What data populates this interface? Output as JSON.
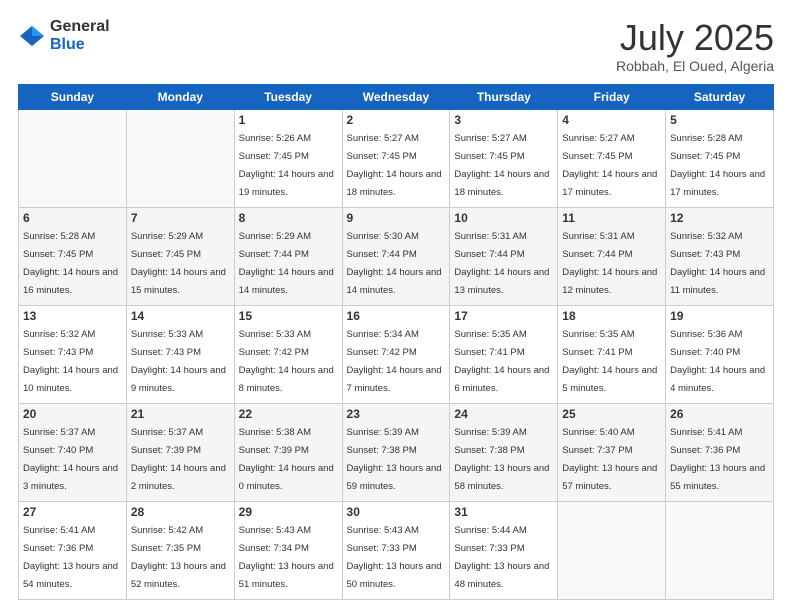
{
  "logo": {
    "general": "General",
    "blue": "Blue"
  },
  "header": {
    "month": "July 2025",
    "location": "Robbah, El Oued, Algeria"
  },
  "weekdays": [
    "Sunday",
    "Monday",
    "Tuesday",
    "Wednesday",
    "Thursday",
    "Friday",
    "Saturday"
  ],
  "weeks": [
    [
      {
        "day": "",
        "sunrise": "",
        "sunset": "",
        "daylight": ""
      },
      {
        "day": "",
        "sunrise": "",
        "sunset": "",
        "daylight": ""
      },
      {
        "day": "1",
        "sunrise": "Sunrise: 5:26 AM",
        "sunset": "Sunset: 7:45 PM",
        "daylight": "Daylight: 14 hours and 19 minutes."
      },
      {
        "day": "2",
        "sunrise": "Sunrise: 5:27 AM",
        "sunset": "Sunset: 7:45 PM",
        "daylight": "Daylight: 14 hours and 18 minutes."
      },
      {
        "day": "3",
        "sunrise": "Sunrise: 5:27 AM",
        "sunset": "Sunset: 7:45 PM",
        "daylight": "Daylight: 14 hours and 18 minutes."
      },
      {
        "day": "4",
        "sunrise": "Sunrise: 5:27 AM",
        "sunset": "Sunset: 7:45 PM",
        "daylight": "Daylight: 14 hours and 17 minutes."
      },
      {
        "day": "5",
        "sunrise": "Sunrise: 5:28 AM",
        "sunset": "Sunset: 7:45 PM",
        "daylight": "Daylight: 14 hours and 17 minutes."
      }
    ],
    [
      {
        "day": "6",
        "sunrise": "Sunrise: 5:28 AM",
        "sunset": "Sunset: 7:45 PM",
        "daylight": "Daylight: 14 hours and 16 minutes."
      },
      {
        "day": "7",
        "sunrise": "Sunrise: 5:29 AM",
        "sunset": "Sunset: 7:45 PM",
        "daylight": "Daylight: 14 hours and 15 minutes."
      },
      {
        "day": "8",
        "sunrise": "Sunrise: 5:29 AM",
        "sunset": "Sunset: 7:44 PM",
        "daylight": "Daylight: 14 hours and 14 minutes."
      },
      {
        "day": "9",
        "sunrise": "Sunrise: 5:30 AM",
        "sunset": "Sunset: 7:44 PM",
        "daylight": "Daylight: 14 hours and 14 minutes."
      },
      {
        "day": "10",
        "sunrise": "Sunrise: 5:31 AM",
        "sunset": "Sunset: 7:44 PM",
        "daylight": "Daylight: 14 hours and 13 minutes."
      },
      {
        "day": "11",
        "sunrise": "Sunrise: 5:31 AM",
        "sunset": "Sunset: 7:44 PM",
        "daylight": "Daylight: 14 hours and 12 minutes."
      },
      {
        "day": "12",
        "sunrise": "Sunrise: 5:32 AM",
        "sunset": "Sunset: 7:43 PM",
        "daylight": "Daylight: 14 hours and 11 minutes."
      }
    ],
    [
      {
        "day": "13",
        "sunrise": "Sunrise: 5:32 AM",
        "sunset": "Sunset: 7:43 PM",
        "daylight": "Daylight: 14 hours and 10 minutes."
      },
      {
        "day": "14",
        "sunrise": "Sunrise: 5:33 AM",
        "sunset": "Sunset: 7:43 PM",
        "daylight": "Daylight: 14 hours and 9 minutes."
      },
      {
        "day": "15",
        "sunrise": "Sunrise: 5:33 AM",
        "sunset": "Sunset: 7:42 PM",
        "daylight": "Daylight: 14 hours and 8 minutes."
      },
      {
        "day": "16",
        "sunrise": "Sunrise: 5:34 AM",
        "sunset": "Sunset: 7:42 PM",
        "daylight": "Daylight: 14 hours and 7 minutes."
      },
      {
        "day": "17",
        "sunrise": "Sunrise: 5:35 AM",
        "sunset": "Sunset: 7:41 PM",
        "daylight": "Daylight: 14 hours and 6 minutes."
      },
      {
        "day": "18",
        "sunrise": "Sunrise: 5:35 AM",
        "sunset": "Sunset: 7:41 PM",
        "daylight": "Daylight: 14 hours and 5 minutes."
      },
      {
        "day": "19",
        "sunrise": "Sunrise: 5:36 AM",
        "sunset": "Sunset: 7:40 PM",
        "daylight": "Daylight: 14 hours and 4 minutes."
      }
    ],
    [
      {
        "day": "20",
        "sunrise": "Sunrise: 5:37 AM",
        "sunset": "Sunset: 7:40 PM",
        "daylight": "Daylight: 14 hours and 3 minutes."
      },
      {
        "day": "21",
        "sunrise": "Sunrise: 5:37 AM",
        "sunset": "Sunset: 7:39 PM",
        "daylight": "Daylight: 14 hours and 2 minutes."
      },
      {
        "day": "22",
        "sunrise": "Sunrise: 5:38 AM",
        "sunset": "Sunset: 7:39 PM",
        "daylight": "Daylight: 14 hours and 0 minutes."
      },
      {
        "day": "23",
        "sunrise": "Sunrise: 5:39 AM",
        "sunset": "Sunset: 7:38 PM",
        "daylight": "Daylight: 13 hours and 59 minutes."
      },
      {
        "day": "24",
        "sunrise": "Sunrise: 5:39 AM",
        "sunset": "Sunset: 7:38 PM",
        "daylight": "Daylight: 13 hours and 58 minutes."
      },
      {
        "day": "25",
        "sunrise": "Sunrise: 5:40 AM",
        "sunset": "Sunset: 7:37 PM",
        "daylight": "Daylight: 13 hours and 57 minutes."
      },
      {
        "day": "26",
        "sunrise": "Sunrise: 5:41 AM",
        "sunset": "Sunset: 7:36 PM",
        "daylight": "Daylight: 13 hours and 55 minutes."
      }
    ],
    [
      {
        "day": "27",
        "sunrise": "Sunrise: 5:41 AM",
        "sunset": "Sunset: 7:36 PM",
        "daylight": "Daylight: 13 hours and 54 minutes."
      },
      {
        "day": "28",
        "sunrise": "Sunrise: 5:42 AM",
        "sunset": "Sunset: 7:35 PM",
        "daylight": "Daylight: 13 hours and 52 minutes."
      },
      {
        "day": "29",
        "sunrise": "Sunrise: 5:43 AM",
        "sunset": "Sunset: 7:34 PM",
        "daylight": "Daylight: 13 hours and 51 minutes."
      },
      {
        "day": "30",
        "sunrise": "Sunrise: 5:43 AM",
        "sunset": "Sunset: 7:33 PM",
        "daylight": "Daylight: 13 hours and 50 minutes."
      },
      {
        "day": "31",
        "sunrise": "Sunrise: 5:44 AM",
        "sunset": "Sunset: 7:33 PM",
        "daylight": "Daylight: 13 hours and 48 minutes."
      },
      {
        "day": "",
        "sunrise": "",
        "sunset": "",
        "daylight": ""
      },
      {
        "day": "",
        "sunrise": "",
        "sunset": "",
        "daylight": ""
      }
    ]
  ]
}
